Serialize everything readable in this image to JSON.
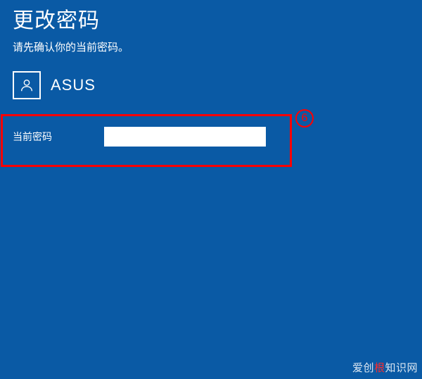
{
  "header": {
    "title": "更改密码",
    "subtitle": "请先确认你的当前密码。"
  },
  "user": {
    "name": "ASUS"
  },
  "form": {
    "current_password_label": "当前密码",
    "current_password_value": ""
  },
  "annotation": {
    "step_number": "6"
  },
  "watermark": {
    "prefix": "爱创",
    "highlight": "根",
    "suffix": "知识网"
  }
}
